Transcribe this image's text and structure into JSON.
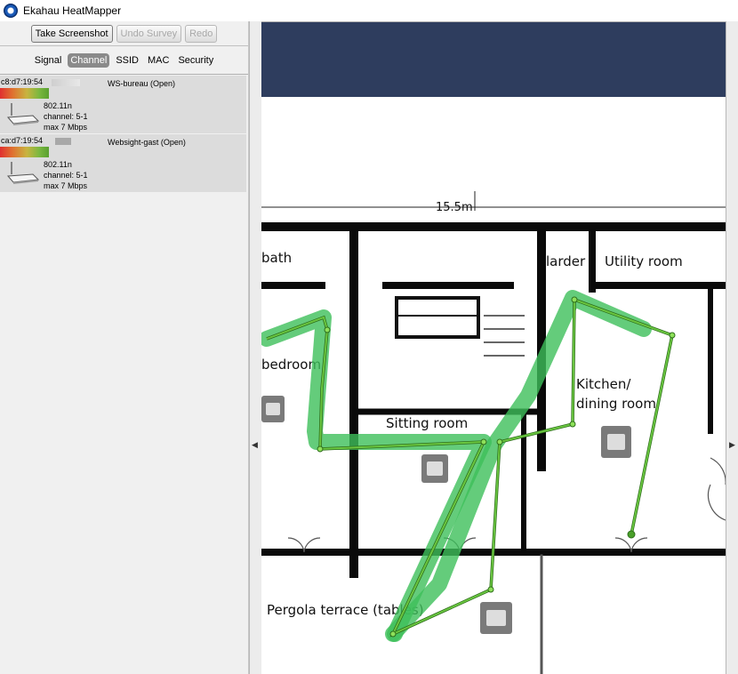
{
  "window": {
    "title": "Ekahau HeatMapper"
  },
  "toolbar": {
    "screenshot_label": "Take Screenshot",
    "undo_label": "Undo Survey",
    "redo_label": "Redo"
  },
  "tabs": [
    "Signal",
    "Channel",
    "SSID",
    "MAC",
    "Security"
  ],
  "active_tab": "Channel",
  "networks": [
    {
      "mac": "c8:d7:19:54",
      "ssid": "WS-bureau (Open)",
      "standard": "802.11n",
      "channel": "channel: 5-1",
      "rate": "max 7 Mbps"
    },
    {
      "mac": "ca:d7:19:54",
      "ssid": "Websight-gast (Open)",
      "standard": "802.11n",
      "channel": "channel: 5-1",
      "rate": "max 7 Mbps"
    }
  ],
  "map": {
    "dimension_label": "15.5m",
    "rooms": {
      "bath": "bath",
      "bedroom": "bedroom",
      "larder": "larder",
      "utility": "Utility room",
      "kitchen": "Kitchen/",
      "dining": "dining room",
      "sitting": "Sitting room",
      "pergola": "Pergola terrace (tables)"
    }
  },
  "colors": {
    "header_band": "#2e3d5e",
    "path_line": "#7bd04b",
    "coverage": "#3dbf5a",
    "walls": "#0a0a0a"
  }
}
